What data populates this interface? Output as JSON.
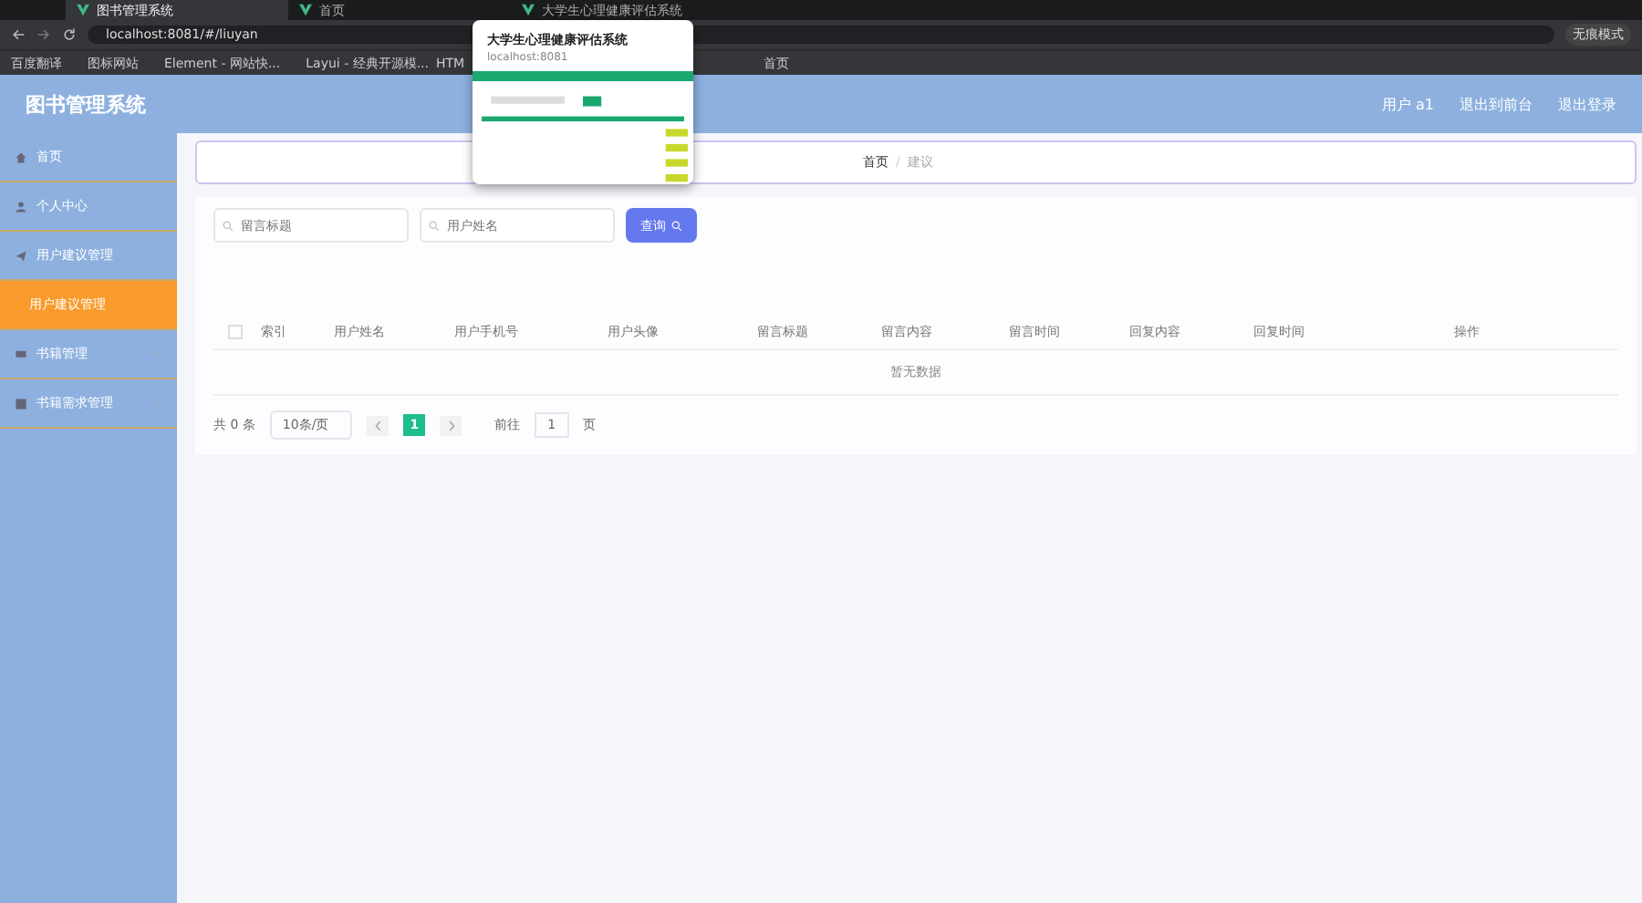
{
  "browser": {
    "tabs": [
      {
        "title": "图书管理系统",
        "selected": true
      },
      {
        "title": "首页",
        "selected": false
      },
      {
        "title": "大学生心理健康评估系统",
        "selected": false
      }
    ],
    "address": "localhost:8081/#/liuyan",
    "profile": "无痕模式",
    "bookmarks": [
      "百度翻译",
      "图标网站",
      "Element - 网站快...",
      "Layui - 经典开源模...",
      "HTM",
      "首页"
    ]
  },
  "tab_preview": {
    "title": "大学生心理健康评估系统",
    "url": "localhost:8081"
  },
  "app": {
    "title": "图书管理系统",
    "header_links": [
      "用户 a1",
      "退出到前台",
      "退出登录"
    ],
    "sidebar": [
      {
        "label": "首页",
        "kind": "link",
        "selected": false
      },
      {
        "label": "个人中心",
        "kind": "link",
        "selected": false
      },
      {
        "label": "用户建议管理",
        "kind": "group",
        "selected": false,
        "children": [
          {
            "label": "用户建议管理",
            "selected": true
          }
        ]
      },
      {
        "label": "书籍管理",
        "kind": "group",
        "selected": false
      },
      {
        "label": "书籍需求管理",
        "kind": "group",
        "selected": false
      }
    ],
    "breadcrumb": [
      "首页",
      "建议"
    ],
    "breadcrumb_separator": "/",
    "search": [
      {
        "placeholder": "留言标题"
      },
      {
        "placeholder": "用户姓名"
      }
    ],
    "search_button": "查询",
    "table": {
      "select_all": {
        "checked": false
      },
      "columns": [
        "索引",
        "用户姓名",
        "用户手机号",
        "用户头像",
        "留言标题",
        "留言内容",
        "留言时间",
        "回复内容",
        "回复时间",
        "操作"
      ],
      "empty_text": "暂无数据"
    },
    "pagination": {
      "total": "共 0 条",
      "page_size": "10条/页",
      "pages": [
        {
          "label": "1",
          "selected": true
        }
      ],
      "goto_label": "前往",
      "goto_value": "1",
      "page_suffix": "页"
    }
  }
}
